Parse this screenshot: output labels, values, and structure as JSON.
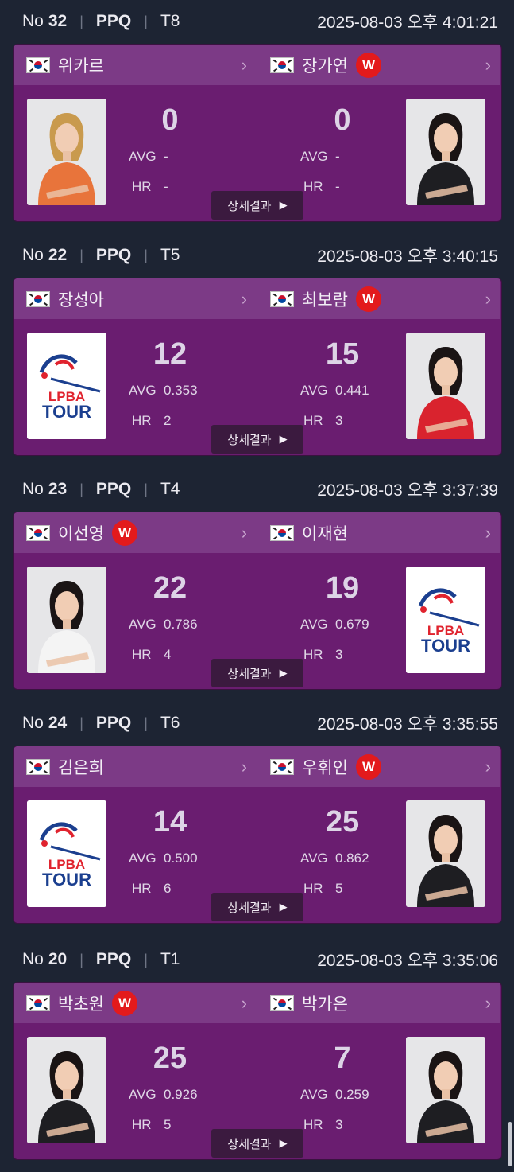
{
  "labels": {
    "avg": "AVG",
    "hr": "HR",
    "detail": "상세결과",
    "no": "No",
    "w_badge": "W"
  },
  "colors": {
    "background": "#1d2433",
    "card": "#6a1d70",
    "card_header": "#7c3a86",
    "win_badge": "#e31a1c"
  },
  "matches": [
    {
      "no": "32",
      "round": "PPQ",
      "table": "T8",
      "datetime": "2025-08-03 오후 4:01:21",
      "left": {
        "name": "위카르",
        "winner": false,
        "score": "0",
        "avg": "-",
        "hr": "-",
        "photo": "player-photo"
      },
      "right": {
        "name": "장가연",
        "winner": true,
        "score": "0",
        "avg": "-",
        "hr": "-",
        "photo": "player-photo"
      }
    },
    {
      "no": "22",
      "round": "PPQ",
      "table": "T5",
      "datetime": "2025-08-03 오후 3:40:15",
      "left": {
        "name": "장성아",
        "winner": false,
        "score": "12",
        "avg": "0.353",
        "hr": "2",
        "photo": "lpba-tour-logo"
      },
      "right": {
        "name": "최보람",
        "winner": true,
        "score": "15",
        "avg": "0.441",
        "hr": "3",
        "photo": "player-photo"
      }
    },
    {
      "no": "23",
      "round": "PPQ",
      "table": "T4",
      "datetime": "2025-08-03 오후 3:37:39",
      "left": {
        "name": "이선영",
        "winner": true,
        "score": "22",
        "avg": "0.786",
        "hr": "4",
        "photo": "player-photo"
      },
      "right": {
        "name": "이재현",
        "winner": false,
        "score": "19",
        "avg": "0.679",
        "hr": "3",
        "photo": "lpba-tour-logo"
      }
    },
    {
      "no": "24",
      "round": "PPQ",
      "table": "T6",
      "datetime": "2025-08-03 오후 3:35:55",
      "left": {
        "name": "김은희",
        "winner": false,
        "score": "14",
        "avg": "0.500",
        "hr": "6",
        "photo": "lpba-tour-logo"
      },
      "right": {
        "name": "우휘인",
        "winner": true,
        "score": "25",
        "avg": "0.862",
        "hr": "5",
        "photo": "player-photo"
      }
    },
    {
      "no": "20",
      "round": "PPQ",
      "table": "T1",
      "datetime": "2025-08-03 오후 3:35:06",
      "left": {
        "name": "박초원",
        "winner": true,
        "score": "25",
        "avg": "0.926",
        "hr": "5",
        "photo": "player-photo"
      },
      "right": {
        "name": "박가은",
        "winner": false,
        "score": "7",
        "avg": "0.259",
        "hr": "3",
        "photo": "player-photo"
      }
    }
  ],
  "logo_text": {
    "line1": "LPBA",
    "line2": "TOUR"
  }
}
